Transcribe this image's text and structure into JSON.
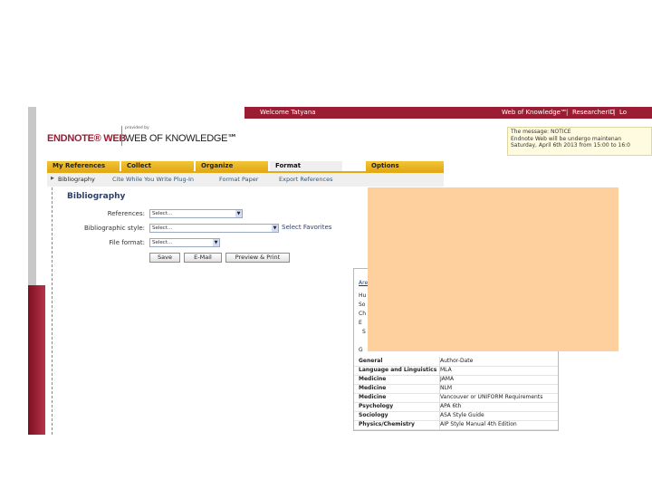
{
  "topbar": {
    "welcome": "Welcome Tatyana",
    "links": [
      "Web of Knowledge℠",
      "|",
      "ResearcherID",
      "|",
      "Lo"
    ]
  },
  "logo": {
    "endnote": "ENDNOTE® WEB",
    "provided_by": "provided by",
    "wok": "WEB OF KNOWLEDGE℠"
  },
  "notice": {
    "line1": "The message: NOTICE",
    "line2": "Endnote Web will be undergo maintenan",
    "line3": "Saturday, April 6th 2013 from 15:00 to 16:0"
  },
  "tabs": [
    {
      "label": "My References"
    },
    {
      "label": "Collect"
    },
    {
      "label": "Organize"
    },
    {
      "label": "Format"
    },
    {
      "label": "Options"
    }
  ],
  "subnav": [
    "Bibliography",
    "Cite While You Write Plug-In",
    "Format Paper",
    "Export References"
  ],
  "bibliography": {
    "title": "Bibliography",
    "references_label": "References:",
    "references_value": "Select...",
    "style_label": "Bibliographic style:",
    "style_value": "Select...",
    "select_favorites": "Select Favorites",
    "format_label": "File format:",
    "format_value": "Select...",
    "buttons": {
      "save": "Save",
      "email": "E-Mail",
      "preview": "Preview & Print"
    }
  },
  "styles_table": {
    "header_fragment": "Are",
    "left_fragments": [
      "Hu",
      "So",
      "Ch",
      "E",
      "S",
      "G"
    ],
    "rows": [
      {
        "discipline": "General",
        "style": "Author-Date"
      },
      {
        "discipline": "Language and Linguistics",
        "style": "MLA"
      },
      {
        "discipline": "Medicine",
        "style": "JAMA"
      },
      {
        "discipline": "Medicine",
        "style": "NLM"
      },
      {
        "discipline": "Medicine",
        "style": "Vancouver or UNIFORM Requirements"
      },
      {
        "discipline": "Psychology",
        "style": "APA 6th"
      },
      {
        "discipline": "Sociology",
        "style": "ASA Style Guide"
      },
      {
        "discipline": "Physics/Chemistry",
        "style": "AIP Style Manual 4th Edition"
      }
    ]
  },
  "colors": {
    "brand_red": "#9a1d33",
    "tab_yellow": "#e3a917",
    "overlay_peach": "#fed09d"
  }
}
